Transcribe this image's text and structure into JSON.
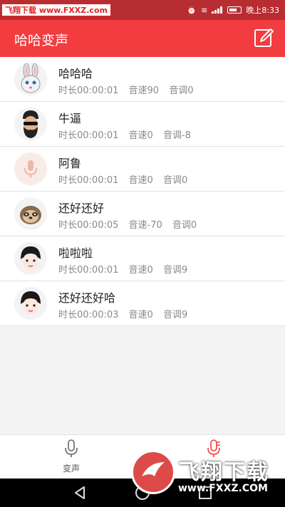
{
  "status_bar": {
    "watermark": "飞翔下载 www.FXXZ.com",
    "time": "晚上8:33"
  },
  "app_bar": {
    "title": "哈哈变声",
    "edit_icon": "edit-icon"
  },
  "recordings": [
    {
      "name": "哈哈哈",
      "duration": "时长00:00:01",
      "speed": "音速90",
      "pitch": "音调0",
      "avatar": "rabbit"
    },
    {
      "name": "牛逼",
      "duration": "时长00:00:01",
      "speed": "音速0",
      "pitch": "音调-8",
      "avatar": "bearded-man"
    },
    {
      "name": "阿鲁",
      "duration": "时长00:00:01",
      "speed": "音速0",
      "pitch": "音调0",
      "avatar": "microphone"
    },
    {
      "name": "还好还好",
      "duration": "时长00:00:05",
      "speed": "音速-70",
      "pitch": "音调0",
      "avatar": "sloth"
    },
    {
      "name": "啦啦啦",
      "duration": "时长00:00:01",
      "speed": "音速0",
      "pitch": "音调9",
      "avatar": "girl"
    },
    {
      "name": "还好还好哈",
      "duration": "时长00:00:03",
      "speed": "音速0",
      "pitch": "音调9",
      "avatar": "girl"
    }
  ],
  "tab_bar": {
    "tabs": [
      {
        "label": "变声",
        "icon": "microphone-icon",
        "active": false
      },
      {
        "label": "",
        "icon": "microphone-list-icon",
        "active": true
      }
    ]
  },
  "watermark_overlay": {
    "brand": "飞翔下载",
    "url": "www.FXXZ.COM"
  },
  "colors": {
    "accent": "#f23c3f",
    "status_bar": "#b72d31"
  }
}
